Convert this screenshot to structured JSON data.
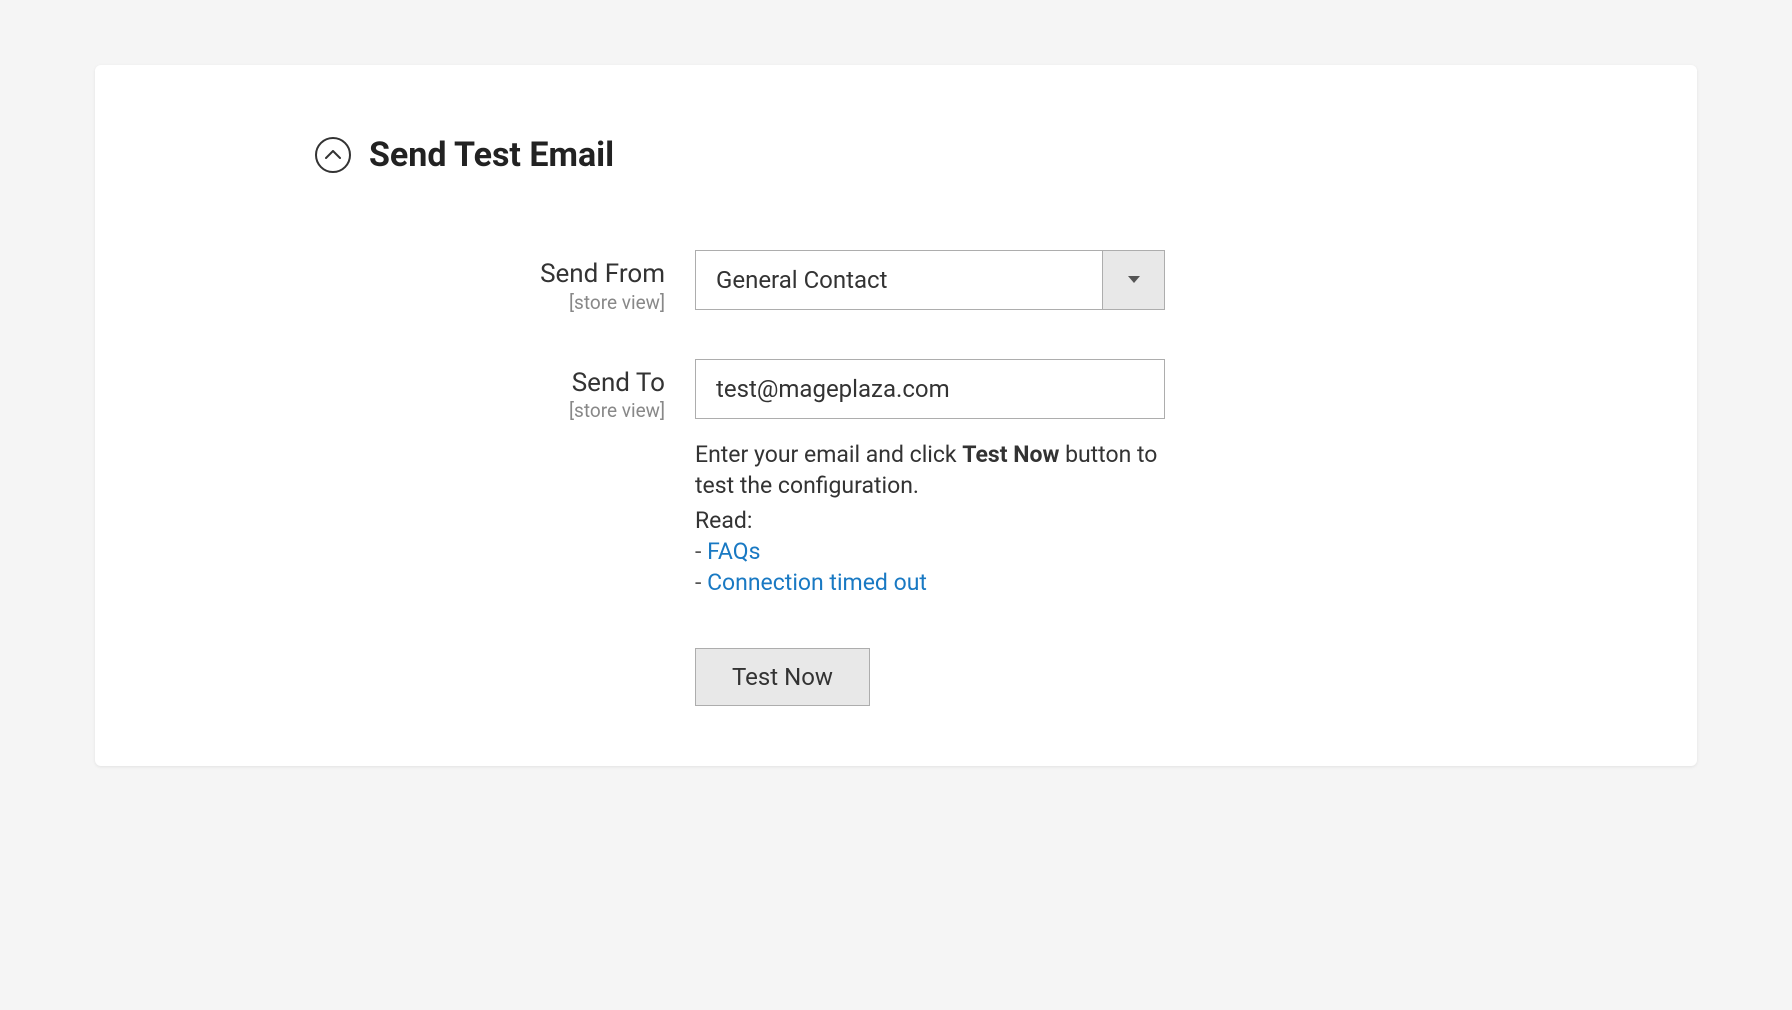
{
  "section": {
    "title": "Send Test Email"
  },
  "fields": {
    "sendFrom": {
      "label": "Send From",
      "scope": "[store view]",
      "value": "General Contact"
    },
    "sendTo": {
      "label": "Send To",
      "scope": "[store view]",
      "value": "test@mageplaza.com"
    }
  },
  "helper": {
    "line1_pre": "Enter your email and click ",
    "line1_bold": "Test Now",
    "line1_post": " button to test the configuration.",
    "readLabel": "Read:",
    "dash": "- ",
    "links": {
      "faqs": "FAQs",
      "timeout": "Connection timed out"
    }
  },
  "actions": {
    "testNow": "Test Now"
  }
}
